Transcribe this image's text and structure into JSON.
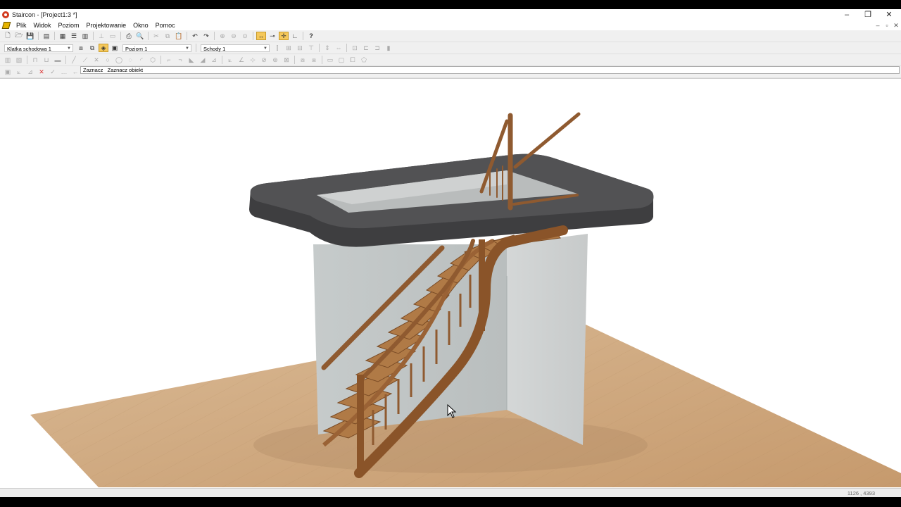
{
  "window": {
    "title": "Staircon - [Project1:3 *]",
    "controls": {
      "minimize": "–",
      "restore": "❐",
      "close": "✕"
    },
    "mdi_controls": {
      "minimize": "–",
      "restore": "▫",
      "close": "✕"
    }
  },
  "menu": {
    "items": [
      "Plik",
      "Widok",
      "Poziom",
      "Projektowanie",
      "Okno",
      "Pomoc"
    ]
  },
  "toolbar2": {
    "stairwell_select": "Klatka schodowa 1",
    "level_select": "Poziom 1",
    "stairs_select": "Schody 1"
  },
  "command": {
    "mode": "Zaznacz",
    "prompt": "Zaznacz obiekt"
  },
  "status": {
    "coordinates": "1126 , 4393"
  },
  "colors": {
    "floor": "#c9a27a",
    "wall": "#c4c8c8",
    "slab": "#4a4a4c",
    "wood": "#9a5e32",
    "highlight": "#f5c85a"
  }
}
